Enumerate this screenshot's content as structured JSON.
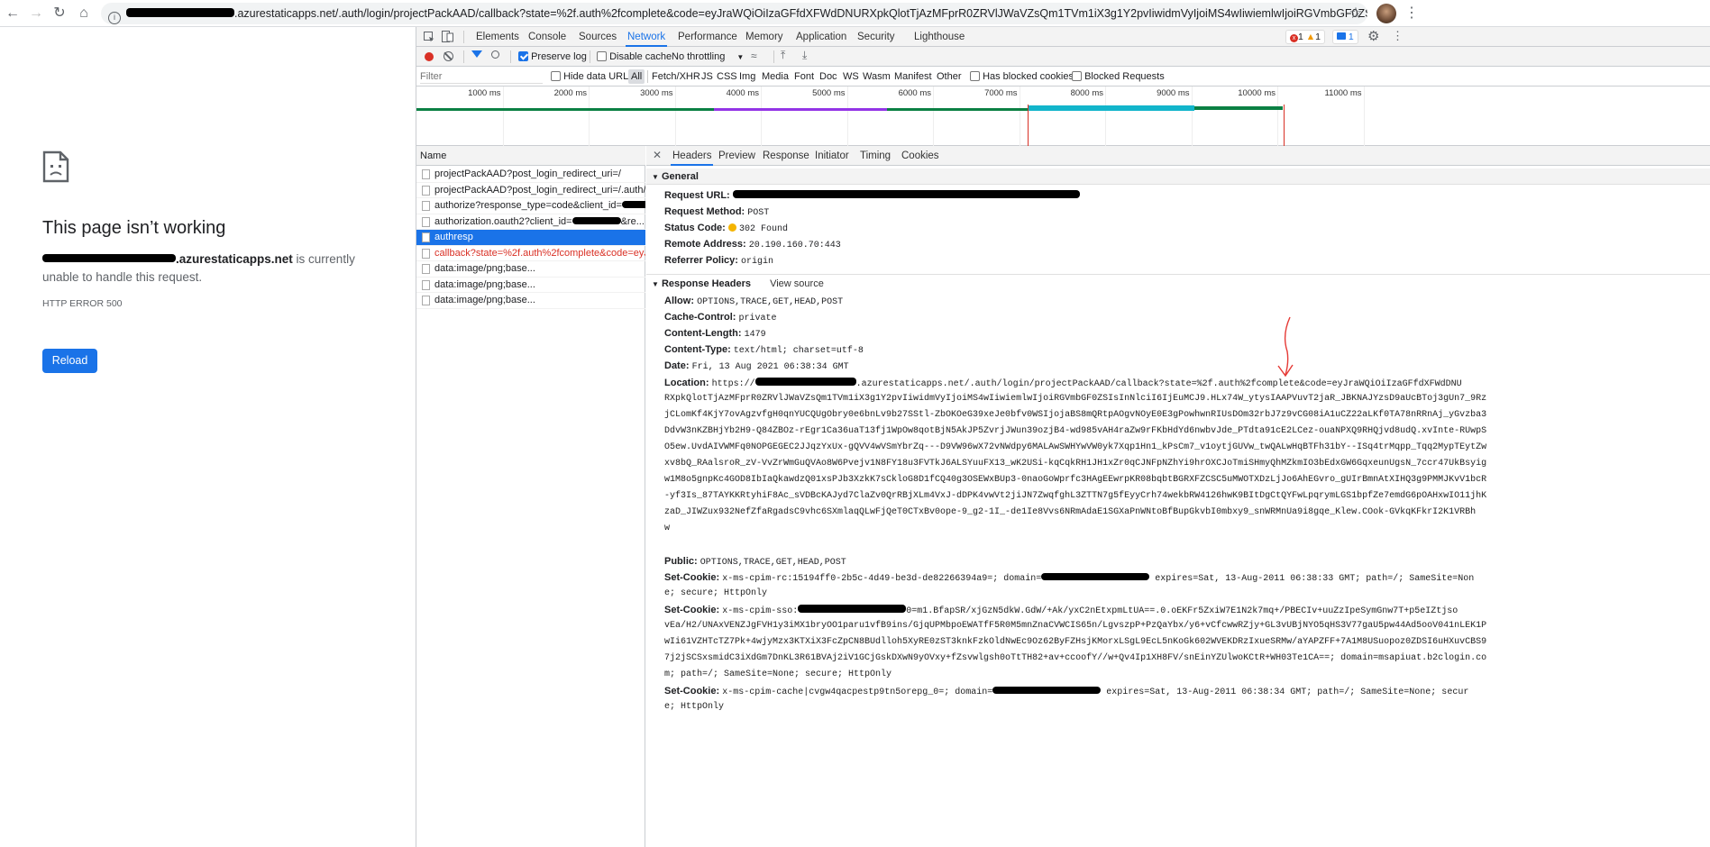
{
  "browser": {
    "url_text": ".azurestaticapps.net/.auth/login/projectPackAAD/callback?state=%2f.auth%2fcomplete&code=eyJraWQiOiIzaGFfdXFWdDNURXpkQlotTjAzMFprR0ZRVlJWaVZsQm1TVm1iX3g1Y2pvIiwidmVyIjoiMS4wIiwiemlwIjoiRGVmbGF0ZSIsInNlciI6IjEu...",
    "back_icon": "back-arrow-icon",
    "forward_icon": "forward-arrow-icon",
    "reload_icon": "reload-icon",
    "home_icon": "home-icon"
  },
  "error_page": {
    "title": "This page isn’t working",
    "host_suffix": ".azurestaticapps.net",
    "message_part1": " is currently",
    "message_part2": "unable to handle this request.",
    "error_code": "HTTP ERROR 500",
    "reload_label": "Reload"
  },
  "devtools": {
    "tabs": [
      "Elements",
      "Console",
      "Sources",
      "Network",
      "Performance",
      "Memory",
      "Application",
      "Security",
      "Lighthouse"
    ],
    "active_tab": "Network",
    "error_count": "1",
    "warning_count": "1",
    "message_count": "1",
    "toolbar": {
      "preserve_log": "Preserve log",
      "disable_cache": "Disable cache",
      "throttling": "No throttling"
    },
    "filter": {
      "placeholder": "Filter",
      "hide_data_urls": "Hide data URLs",
      "types": [
        "All",
        "Fetch/XHR",
        "JS",
        "CSS",
        "Img",
        "Media",
        "Font",
        "Doc",
        "WS",
        "Wasm",
        "Manifest",
        "Other"
      ],
      "has_blocked_cookies": "Has blocked cookies",
      "blocked_requests": "Blocked Requests"
    },
    "timeline_ticks": [
      "1000 ms",
      "2000 ms",
      "3000 ms",
      "4000 ms",
      "5000 ms",
      "6000 ms",
      "7000 ms",
      "8000 ms",
      "9000 ms",
      "10000 ms",
      "11000 ms"
    ],
    "name_header": "Name",
    "requests": [
      {
        "name": "projectPackAAD?post_login_redirect_uri=/",
        "state": "normal"
      },
      {
        "name": "projectPackAAD?post_login_redirect_uri=/.auth/co...",
        "state": "normal"
      },
      {
        "name": "authorize?response_type=code&client_id=",
        "state": "normal"
      },
      {
        "name": "authorization.oauth2?client_id=",
        "suffix": "&re...",
        "state": "normal"
      },
      {
        "name": "authresp",
        "state": "selected"
      },
      {
        "name": "callback?state=%2f.auth%2fcomplete&code=eyJra...",
        "state": "error"
      },
      {
        "name": "data:image/png;base...",
        "state": "normal"
      },
      {
        "name": "data:image/png;base...",
        "state": "normal"
      },
      {
        "name": "data:image/png;base...",
        "state": "normal"
      }
    ],
    "detail_tabs": [
      "Headers",
      "Preview",
      "Response",
      "Initiator",
      "Timing",
      "Cookies"
    ],
    "active_detail_tab": "Headers",
    "general": {
      "section_label": "General",
      "request_url_label": "Request URL:",
      "request_method_label": "Request Method:",
      "request_method": "POST",
      "status_code_label": "Status Code:",
      "status_code": "302 Found",
      "remote_address_label": "Remote Address:",
      "remote_address": "20.190.160.70:443",
      "referrer_policy_label": "Referrer Policy:",
      "referrer_policy": "origin"
    },
    "response_headers": {
      "section_label": "Response Headers",
      "view_source": "View source",
      "allow_label": "Allow:",
      "allow": "OPTIONS,TRACE,GET,HEAD,POST",
      "cache_control_label": "Cache-Control:",
      "cache_control": "private",
      "content_length_label": "Content-Length:",
      "content_length": "1479",
      "content_type_label": "Content-Type:",
      "content_type": "text/html; charset=utf-8",
      "date_label": "Date:",
      "date": "Fri, 13 Aug 2021 06:38:34 GMT",
      "location_label": "Location:",
      "location_prefix": "https://",
      "location_lines": [
        ".azurestaticapps.net/.auth/login/projectPackAAD/callback?state=%2f.auth%2fcomplete&code=eyJraWQiOiIzaGFfdXFWdDNU",
        "RXpkQlotTjAzMFprR0ZRVlJWaVZsQm1TVm1iX3g1Y2pvIiwidmVyIjoiMS4wIiwiemlwIjoiRGVmbGF0ZSIsInNlciI6IjEuMCJ9.HLx74W_ytysIAAPVuvT2jaR_JBKNAJYzsD9aUcBToj3gUn7_9Rz",
        "jCLomKf4KjY7ovAgzvfgH0qnYUCQUgObry0e6bnLv9b27SStl-ZbOKOeG39xeJe0bfv0WSIjojaBS8mQRtpAOgvNOyE0E3gPowhwnRIUsDOm32rbJ7z9vCG08iA1uCZ22aLKf0TA78nRRnAj_yGvzba3",
        "DdvW3nKZBHjYb2H9-Q84ZBOz-rEgr1Ca36uaT13fj1WpOw8qotBjN5AkJP5ZvrjJWun39ozjB4-wd985vAH4raZw9rFKbHdYd6nwbvJde_PTdta91cE2LCez-ouaNPXQ9RHQjvd8udQ.xvInte-RUwpS",
        "O5ew.UvdAIVWMFq0NOPGEGEC2JJqzYxUx-gQVV4wVSmYbrZq---D9VW96wX72vNWdpy6MALAwSWHYwVW0yk7Xqp1Hn1_kPsCm7_v1oytjGUVw_twQALwHqBTFh31bY--ISq4trMqpp_Tqq2MypTEytZw",
        "xv8bQ_RAalsroR_zV-VvZrWmGuQVAo8W6Pvejv1N8FY18u3FVTkJ6ALSYuuFX13_wK2USi-kqCqkRH1JH1xZr0qCJNFpNZhYi9hrOXCJoTmiSHmyQhMZkmIO3bEdxGW6GqxeunUgsN_7ccr47UkBsyig",
        "w1M8o5gnpKc4GOD8IbIaQkawdzQ01xsPJb3XzkK7sCkloG8D1fCQ40g3OSEWxBUp3-0naoGoWprfc3HAgEEwrpKR08bqbtBGRXFZCSC5uMWOTXDzLjJo6AhEGvro_gUIrBmnAtXIHQ3g9PMMJKvV1bcR",
        "-yf3Is_87TAYKKRtyhiF8Ac_sVDBcKAJyd7ClaZv0QrRBjXLm4VxJ-dDPK4vwVt2jiJN7ZwqfghL3ZTTN7g5fEyyCrh74wekbRW4126hwK9BItDgCtQYFwLpqrymLGS1bpfZe7emdG6pOAHxwIO11jhK",
        "zaD_JIWZux932NefZfaRgadsC9vhc6SXmlaqQLwFjQeT0CTxBv0ope-9_g2-1I_-de1Ie8Vvs6NRmAdaE1SGXaPnWNtoBfBupGkvbI0mbxy9_snWRMnUa9i8gqe_Klew.COok-GVkqKFkrI2K1VRBh",
        "w"
      ],
      "public_label": "Public:",
      "public": "OPTIONS,TRACE,GET,HEAD,POST",
      "cookie_label": "Set-Cookie:",
      "cookie1_lines": [
        "x-ms-cpim-rc:15194ff0-2b5c-4d49-be3d-de82266394a9=; domain=",
        "e; secure; HttpOnly"
      ],
      "cookie1_suffix": " expires=Sat, 13-Aug-2011 06:38:33 GMT; path=/; SameSite=Non",
      "cookie2_lines": [
        "x-ms-cpim-sso:",
        "vEa/H2/UNAxVENZJgFVH1y3iMX1bryOO1paru1vfB9ins/GjqUPMbpoEWATfF5R0M5mnZnaCVWCIS65n/LgvszpP+PzQaYbx/y6+vCfcwwRZjy+GL3vUBjNYO5qHS3V77gaU5pw44Ad5ooV041nLEK1P",
        "wIi61VZHTcTZ7Pk+4wjyMzx3KTXiX3FcZpCN8BUdlloh5XyRE0zST3knkFzkOldNwEc9Oz62ByFZHsjKMorxLSgL9EcL5nKoGk602WVEKDRzIxueSRMw/aYAPZFF+7A1M8USuopoz0ZDSI6uHXuvCBS9",
        "7j2jSCSxsmidC3iXdGm7DnKL3R61BVAj2iV1GCjGskDXwN9yOVxy+fZsvwlgsh0oTtTH82+av+ccoofY//w+Qv4Ip1XH8FV/snEinYZUlwoKCtR+WH03Te1CA==; domain=msapiuat.b2clogin.co",
        "m; path=/; SameSite=None; secure; HttpOnly"
      ],
      "cookie2_suffix": "0=m1.BfapSR/xjGzN5dkW.GdW/+Ak/yxC2nEtxpmLtUA==.0.oEKFr5ZxiW7E1N2k7mq+/PBECIv+uuZzIpeSymGnw7T+p5eIZtjso",
      "cookie3_lines": [
        "x-ms-cpim-cache|cvgw4qacpestp9tn5orepg_0=; domain=",
        "e; HttpOnly"
      ],
      "cookie3_suffix": " expires=Sat, 13-Aug-2011 06:38:34 GMT; path=/; SameSite=None; secur"
    }
  }
}
